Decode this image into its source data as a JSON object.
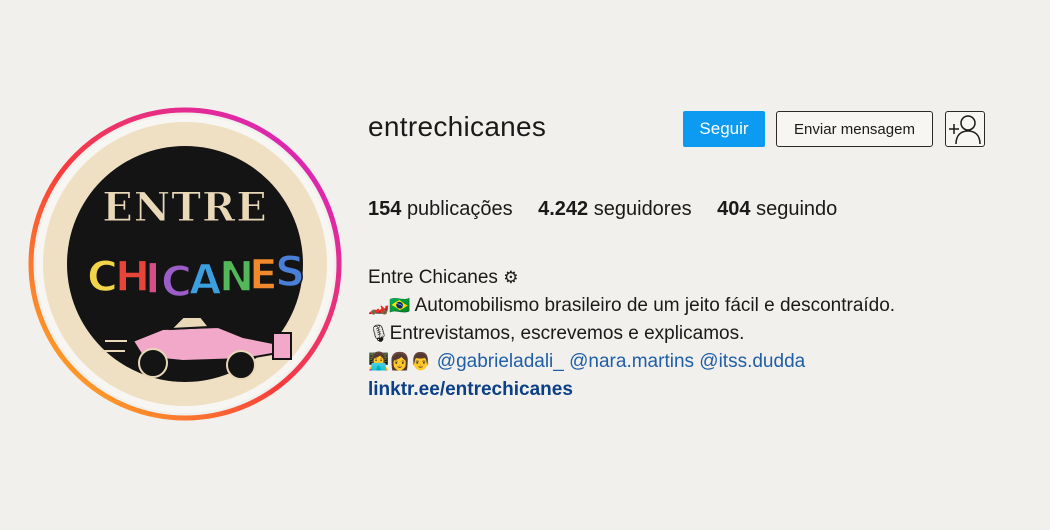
{
  "profile": {
    "username": "entrechicanes",
    "avatar_logo_text": [
      "ENTRE",
      "CHICANES"
    ],
    "buttons": {
      "follow_label": "Seguir",
      "message_label": "Enviar mensagem",
      "add_user_icon": "add-user-icon"
    },
    "stats": [
      {
        "count": "154",
        "label": "publicações"
      },
      {
        "count": "4.242",
        "label": "seguidores"
      },
      {
        "count": "404",
        "label": "seguindo"
      }
    ],
    "bio": {
      "name": "Entre Chicanes",
      "name_emoji": "⚙",
      "line1_emoji": "🏎️🇧🇷",
      "line1_text": "Automobilismo brasileiro de um jeito fácil e descontraído.",
      "line2_emoji": "🎙",
      "line2_text": "Entrevistamos, escrevemos e explicamos.",
      "line3_emoji": "👩‍💻👩👨",
      "mentions": [
        "@gabrieladali_",
        "@nara.martins",
        "@itss.dudda"
      ],
      "link": "linktr.ee/entrechicanes"
    }
  },
  "colors": {
    "background": "#f1f0ec",
    "follow_button": "#0d9bf2",
    "mention": "#1f5ea8",
    "link": "#0b3f86"
  }
}
